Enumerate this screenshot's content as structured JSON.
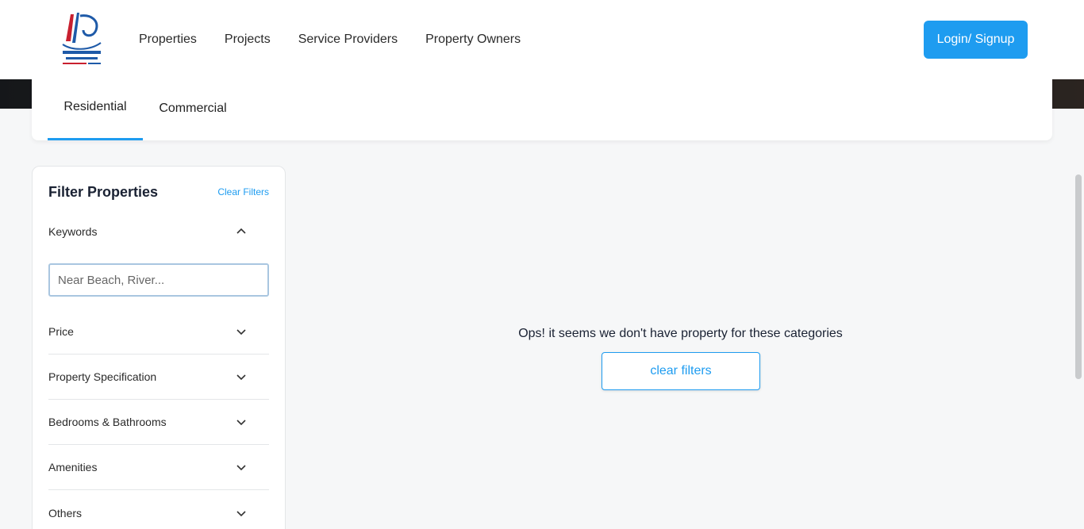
{
  "header": {
    "nav": [
      "Properties",
      "Projects",
      "Service Providers",
      "Property Owners"
    ],
    "login_label": "Login/ Signup",
    "logo_icon": "abu-dhabi-united-real-estate-logo"
  },
  "tabs": {
    "items": [
      "Residential",
      "Commercial"
    ],
    "active": "Residential"
  },
  "filters": {
    "title": "Filter Properties",
    "clear_label": "Clear Filters",
    "keywords": {
      "label": "Keywords",
      "placeholder": "Near Beach, River...",
      "value": ""
    },
    "sections": [
      "Price",
      "Property Specification",
      "Bedrooms & Bathrooms",
      "Amenities",
      "Others"
    ]
  },
  "results": {
    "empty_message": "Ops! it seems we don't have property for these categories",
    "clear_button": "clear filters"
  },
  "colors": {
    "accent": "#1e9cf0",
    "title": "#1a2233",
    "background": "#f6f7f8"
  }
}
